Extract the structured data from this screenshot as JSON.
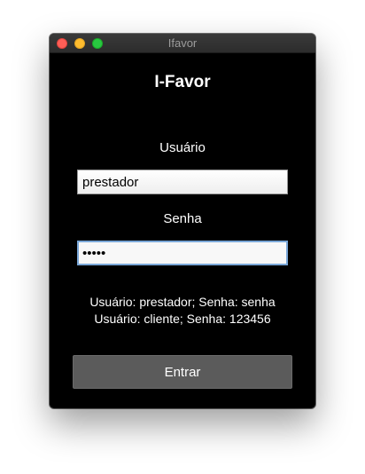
{
  "window": {
    "title": "Ifavor"
  },
  "app": {
    "title": "I-Favor"
  },
  "login": {
    "username_label": "Usuário",
    "username_value": "prestador",
    "password_label": "Senha",
    "password_value": "senha",
    "hint_line_1": "Usuário: prestador; Senha: senha",
    "hint_line_2": "Usuário: cliente; Senha: 123456",
    "submit_label": "Entrar"
  },
  "colors": {
    "background": "#000000",
    "button": "#5b5b5b",
    "focus_ring": "#7aa7d8",
    "close": "#fe5f57",
    "minimize": "#febc2e",
    "maximize": "#28c840"
  }
}
